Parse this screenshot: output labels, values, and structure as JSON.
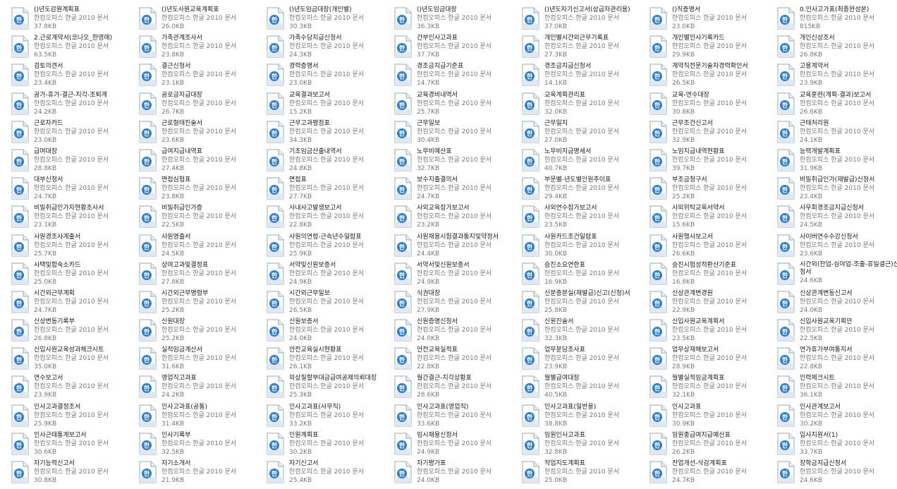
{
  "file_type_label": "한컴오피스 한글 2010 문서",
  "icon": "hwp-document-icon",
  "accent": "#2f7fd0",
  "columns": 7,
  "files": [
    {
      "name": "()년도감원계획표",
      "size": "37.8KB"
    },
    {
      "name": "()년도사원교육계획표",
      "size": "26.0KB"
    },
    {
      "name": "()년도임금대장(개인별)",
      "size": "30.3KB"
    },
    {
      "name": "()년도임금대장",
      "size": "36.3KB"
    },
    {
      "name": "()년도자기신고서(상급자관리용)",
      "size": "37.0KB"
    },
    {
      "name": "()직증명서",
      "size": "23.0KB"
    },
    {
      "name": "0.인사고가표(최종완성본)",
      "size": "815KB"
    },
    {
      "name": "2.근로계약서(코나오_한영애)",
      "size": "63.5KB"
    },
    {
      "name": "가족관계조사서",
      "size": "23.8KB"
    },
    {
      "name": "가족수당지급신청서",
      "size": "24.3KB"
    },
    {
      "name": "간부인사고과표",
      "size": "37.7KB"
    },
    {
      "name": "개인별시간외근무기록표",
      "size": "27.3KB"
    },
    {
      "name": "개인별인사기록카드",
      "size": "29.9KB"
    },
    {
      "name": "개인신상조서",
      "size": "26.8KB"
    },
    {
      "name": "검토의견서",
      "size": "23.4KB"
    },
    {
      "name": "결근신청서",
      "size": "23.1KB"
    },
    {
      "name": "경력증명서",
      "size": "23.0KB"
    },
    {
      "name": "경조금지급기준표",
      "size": "14.7KB"
    },
    {
      "name": "경조금지급신청서",
      "size": "14.1KB"
    },
    {
      "name": "계약직전문기술자경력확인서",
      "size": "26.5KB"
    },
    {
      "name": "고용계약서",
      "size": "23.9KB"
    },
    {
      "name": "공가-휴가-결근-지각-조퇴계",
      "size": "24.2KB"
    },
    {
      "name": "공로금지급대장",
      "size": "26.7KB"
    },
    {
      "name": "교육결과보고서",
      "size": "15.2KB"
    },
    {
      "name": "교육경비내역서",
      "size": "25.7KB"
    },
    {
      "name": "교육계획관리표",
      "size": "32.0KB"
    },
    {
      "name": "교육-연수대장",
      "size": "30.8KB"
    },
    {
      "name": "교육훈련(계획-결과)보고서",
      "size": "26.6KB"
    },
    {
      "name": "근로자카드",
      "size": "23.0KB"
    },
    {
      "name": "근로형태진술서",
      "size": "23.6KB"
    },
    {
      "name": "근무고과평정표",
      "size": "34.3KB"
    },
    {
      "name": "근무일보",
      "size": "30.4KB"
    },
    {
      "name": "근무일지",
      "size": "27.0KB"
    },
    {
      "name": "근무조건신고서",
      "size": "32.9KB"
    },
    {
      "name": "근태처리원",
      "size": "24.1KB"
    },
    {
      "name": "급여대장",
      "size": "28.8KB"
    },
    {
      "name": "급여지급내역표",
      "size": "27.4KB"
    },
    {
      "name": "기초임금산출내역서",
      "size": "24.8KB"
    },
    {
      "name": "노무비예산표",
      "size": "32.7KB"
    },
    {
      "name": "노무비지급명세서",
      "size": "40.7KB"
    },
    {
      "name": "노임지급내역현황표",
      "size": "39.7KB"
    },
    {
      "name": "능력개발계획표",
      "size": "31.9KB"
    },
    {
      "name": "대부신청서",
      "size": "24.7KB"
    },
    {
      "name": "면접심험표",
      "size": "23.8KB"
    },
    {
      "name": "면접표",
      "size": "27.7KB"
    },
    {
      "name": "보수지출결의서",
      "size": "24.7KB"
    },
    {
      "name": "부문별-년도별인원추이표",
      "size": "29.4KB"
    },
    {
      "name": "부조금청구서",
      "size": "25.2KB"
    },
    {
      "name": "비밀취급인가(재발급)신청서",
      "size": "23.4KB"
    },
    {
      "name": "비밀취급인가자현황조사서",
      "size": "23.1KB"
    },
    {
      "name": "비밀취급인가증",
      "size": "22.5KB"
    },
    {
      "name": "사내사고발생보고서",
      "size": "22.8KB"
    },
    {
      "name": "사외교육참가보고서",
      "size": "23.2KB"
    },
    {
      "name": "사외연수참가보고서",
      "size": "23.5KB"
    },
    {
      "name": "사외위탁교육서약서",
      "size": "15.6KB"
    },
    {
      "name": "사우회경조금지급신청서",
      "size": "24.5KB"
    },
    {
      "name": "사원경조사계출서",
      "size": "25.7KB"
    },
    {
      "name": "사원명출서",
      "size": "24.5KB"
    },
    {
      "name": "사원의연령-근속년수일람표",
      "size": "25.9KB"
    },
    {
      "name": "사원채용시험결과통지및약정서",
      "size": "24.4KB"
    },
    {
      "name": "사원카드조건일람표",
      "size": "30.0KB"
    },
    {
      "name": "사원행사보고서",
      "size": "26.6KB"
    },
    {
      "name": "사이버연수수강신청서",
      "size": "23.6KB"
    },
    {
      "name": "사택및합숙소카드",
      "size": "25.0KB"
    },
    {
      "name": "상여고과및결정표",
      "size": "27.8KB"
    },
    {
      "name": "서약및신원보증서",
      "size": "24.9KB"
    },
    {
      "name": "서약서및신원보증서",
      "size": "24.9KB"
    },
    {
      "name": "승진소요연한표",
      "size": "16.9KB"
    },
    {
      "name": "승진시험성적환산기준표",
      "size": "16.8KB"
    },
    {
      "name": "시간외(잔업-심야업-조출-휴일결근)신청서",
      "size": "24.6KB",
      "wrap": true
    },
    {
      "name": "시간외근무계획",
      "size": "24.7KB"
    },
    {
      "name": "시간외근무명령부",
      "size": "25.2KB"
    },
    {
      "name": "시간외근무일보",
      "size": "26.5KB"
    },
    {
      "name": "식권대장",
      "size": "27.9KB"
    },
    {
      "name": "신분증분실(재발급)신고(신청)서",
      "size": "25.8KB"
    },
    {
      "name": "신상관계변경원",
      "size": "22.9KB"
    },
    {
      "name": "신상관계변동신고서",
      "size": "24.0KB"
    },
    {
      "name": "신상변동기록부",
      "size": "26.8KB"
    },
    {
      "name": "신원대장",
      "size": "25.2KB"
    },
    {
      "name": "신원보증서",
      "size": "24.0KB"
    },
    {
      "name": "신원증명신청서",
      "size": "24.0KB"
    },
    {
      "name": "신원진술서",
      "size": "32.3KB"
    },
    {
      "name": "신입사원교육계획서",
      "size": "23.5KB"
    },
    {
      "name": "신입사원교육기획안",
      "size": "22.5KB"
    },
    {
      "name": "신입사원교육성과체크시트",
      "size": "35.0KB"
    },
    {
      "name": "실적임금계산서",
      "size": "31.6KB"
    },
    {
      "name": "안전교육실시현황표",
      "size": "26.1KB"
    },
    {
      "name": "안전교육실적표",
      "size": "22.8KB"
    },
    {
      "name": "업무분담조사표",
      "size": "23.9KB"
    },
    {
      "name": "업무상재해보고서",
      "size": "28.9KB"
    },
    {
      "name": "연가휴가부여통지서",
      "size": "22.8KB"
    },
    {
      "name": "연수보고서",
      "size": "23.9KB"
    },
    {
      "name": "영업직고과표",
      "size": "24.2KB"
    },
    {
      "name": "외상질할부대금급여공제의뢰대장",
      "size": "25.3KB"
    },
    {
      "name": "월간결근-지각상황표",
      "size": "28.6KB"
    },
    {
      "name": "월별급여대장",
      "size": "40.5KB"
    },
    {
      "name": "월별실적임금계획표",
      "size": "32.1KB"
    },
    {
      "name": "인력체크시트",
      "size": "36.1KB"
    },
    {
      "name": "인사고과결정조서",
      "size": "25.9KB"
    },
    {
      "name": "인사고과표(공통)",
      "size": "31.4KB"
    },
    {
      "name": "인사고과표(사무직)",
      "size": "33.2KB"
    },
    {
      "name": "인사고과표(영업직)",
      "size": "33.6KB"
    },
    {
      "name": "인사고과표(일반용)",
      "size": "38.8KB"
    },
    {
      "name": "인사고과표",
      "size": "30.9KB"
    },
    {
      "name": "인사관계보고서",
      "size": "30.2KB"
    },
    {
      "name": "인사근태통계보고서",
      "size": "30.6KB"
    },
    {
      "name": "인사기록부",
      "size": "32.5KB"
    },
    {
      "name": "인원계획표",
      "size": "30.2KB"
    },
    {
      "name": "임시채용신청서",
      "size": "24.9KB"
    },
    {
      "name": "임원인사고과표",
      "size": "32.8KB"
    },
    {
      "name": "임원충급여지급예산표",
      "size": "26.2KB"
    },
    {
      "name": "입사지원서(1)",
      "size": "33.7KB"
    },
    {
      "name": "자기능력신고서",
      "size": "30.8KB"
    },
    {
      "name": "자기소개서",
      "size": "21.9KB"
    },
    {
      "name": "자기신고서",
      "size": "25.4KB"
    },
    {
      "name": "자기평가표",
      "size": "24.0KB"
    },
    {
      "name": "작업지도계획표",
      "size": "25.0KB"
    },
    {
      "name": "잔업개선-삭감계획표",
      "size": "24.7KB"
    },
    {
      "name": "장학금지급신청서",
      "size": "24.6KB"
    }
  ]
}
